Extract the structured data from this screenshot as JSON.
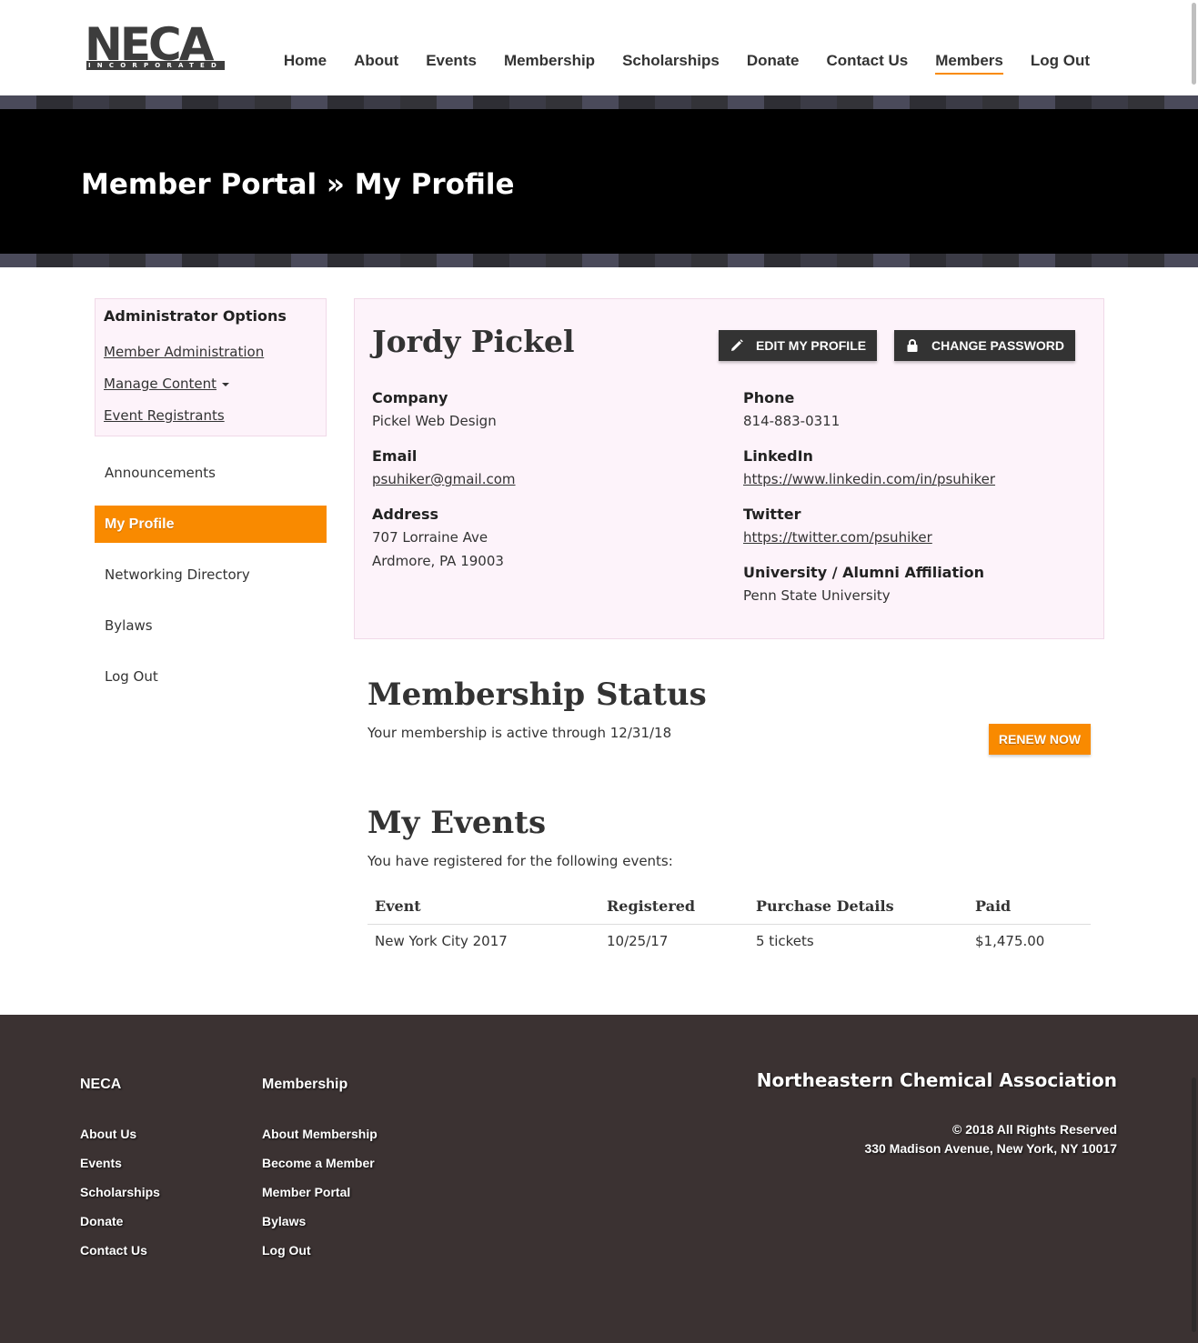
{
  "brand": {
    "logo_text": "NECA",
    "logo_subtext": "INCORPORATED",
    "accent_color": "#f98a00"
  },
  "nav": {
    "items": [
      {
        "label": "Home"
      },
      {
        "label": "About"
      },
      {
        "label": "Events"
      },
      {
        "label": "Membership"
      },
      {
        "label": "Scholarships"
      },
      {
        "label": "Donate"
      },
      {
        "label": "Contact Us"
      },
      {
        "label": "Members",
        "active": true
      },
      {
        "label": "Log Out"
      }
    ]
  },
  "banner": {
    "title": "Member Portal » My Profile"
  },
  "admin": {
    "title": "Administrator Options",
    "links": [
      "Member Administration",
      "Manage Content",
      "Event Registrants"
    ]
  },
  "sidebar": {
    "items": [
      {
        "label": "Announcements"
      },
      {
        "label": "My Profile",
        "active": true
      },
      {
        "label": "Networking Directory"
      },
      {
        "label": "Bylaws"
      },
      {
        "label": "Log Out"
      }
    ]
  },
  "profile": {
    "name": "Jordy Pickel",
    "edit_button": "EDIT MY PROFILE",
    "password_button": "CHANGE PASSWORD",
    "company_label": "Company",
    "company": "Pickel Web Design",
    "email_label": "Email",
    "email": "psuhiker@gmail.com",
    "address_label": "Address",
    "address_line1": "707 Lorraine Ave",
    "address_line2": "Ardmore, PA 19003",
    "phone_label": "Phone",
    "phone": "814-883-0311",
    "linkedin_label": "LinkedIn",
    "linkedin": "https://www.linkedin.com/in/psuhiker",
    "twitter_label": "Twitter",
    "twitter": "https://twitter.com/psuhiker",
    "university_label": "University / Alumni Affiliation",
    "university": "Penn State University"
  },
  "membership": {
    "title": "Membership Status",
    "status_text": "Your membership is active through 12/31/18",
    "renew_button": "RENEW NOW"
  },
  "events": {
    "title": "My Events",
    "intro": "You have registered for the following events:",
    "columns": [
      "Event",
      "Registered",
      "Purchase Details",
      "Paid"
    ],
    "rows": [
      [
        "New York City 2017",
        "10/25/17",
        "5 tickets",
        "$1,475.00"
      ]
    ]
  },
  "footer": {
    "col1_title": "NECA",
    "col1_links": [
      "About Us",
      "Events",
      "Scholarships",
      "Donate",
      "Contact Us"
    ],
    "col2_title": "Membership",
    "col2_links": [
      "About Membership",
      "Become a Member",
      "Member Portal",
      "Bylaws",
      "Log Out"
    ],
    "org_name": "Northeastern Chemical Association",
    "copyright": "© 2018 All Rights Reserved",
    "address": "330 Madison Avenue, New York, NY 10017"
  }
}
